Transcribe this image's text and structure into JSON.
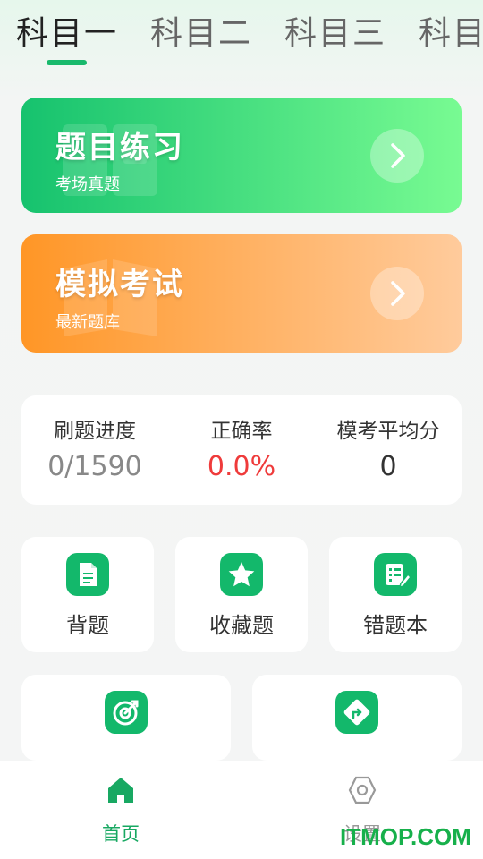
{
  "tabs": [
    {
      "label": "科目一",
      "active": true
    },
    {
      "label": "科目二",
      "active": false
    },
    {
      "label": "科目三",
      "active": false
    },
    {
      "label": "科目四",
      "active": false
    }
  ],
  "cards": {
    "practice": {
      "title": "题目练习",
      "subtitle": "考场真题",
      "icon": "chevron-right-icon"
    },
    "exam": {
      "title": "模拟考试",
      "subtitle": "最新题库",
      "icon": "chevron-right-icon"
    }
  },
  "stats": [
    {
      "label": "刷题进度",
      "value": "0/1590"
    },
    {
      "label": "正确率",
      "value": "0.0%"
    },
    {
      "label": "模考平均分",
      "value": "0"
    }
  ],
  "tools": [
    {
      "label": "背题",
      "icon": "document-icon"
    },
    {
      "label": "收藏题",
      "icon": "star-icon"
    },
    {
      "label": "错题本",
      "icon": "edit-list-icon"
    }
  ],
  "extra_tools": [
    {
      "label": "",
      "icon": "target-icon"
    },
    {
      "label": "",
      "icon": "turn-sign-icon"
    }
  ],
  "bottom_nav": [
    {
      "label": "首页",
      "icon": "home-icon",
      "active": true
    },
    {
      "label": "设置",
      "icon": "settings-icon",
      "active": false
    }
  ],
  "watermark": "ITMOP.COM",
  "colors": {
    "accent": "#18b96c",
    "practice_start": "#16c26e",
    "practice_end": "#78fb92",
    "exam_start": "#ff9626",
    "exam_end": "#ffcb9c",
    "accuracy": "#ef3b3b"
  }
}
